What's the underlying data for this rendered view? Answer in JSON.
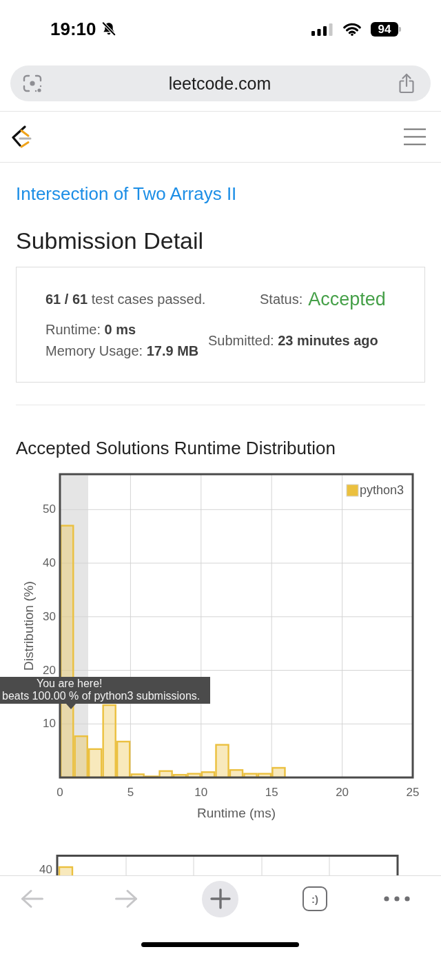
{
  "status_bar": {
    "time": "19:10",
    "battery": "94"
  },
  "address_bar": {
    "url": "leetcode.com"
  },
  "problem_link": "Intersection of Two Arrays II",
  "page_title": "Submission Detail",
  "submission": {
    "cases": "**61 / 61** test cases passed.",
    "status": {
      "label": "Status:",
      "value": "Accepted"
    },
    "runtime": "Runtime: **0 ms**",
    "memory": "Memory Usage: **17.9 MB**",
    "submitted": "Submitted: **23 minutes ago**"
  },
  "distribution": {
    "title": "Accepted Solutions Runtime Distribution",
    "chart_data": {
      "type": "bar",
      "xlabel": "Runtime (ms)",
      "ylabel": "Distribution (%)",
      "x": [
        0.5,
        1.5,
        2.5,
        3.5,
        4.5,
        5.5,
        6.5,
        7.5,
        8.5,
        9.5,
        10.5,
        11.5,
        12.5,
        13.5,
        14.5,
        15.5
      ],
      "series": [
        {
          "name": "python3",
          "color": "#ebc03f",
          "values": [
            47.0,
            7.7,
            5.3,
            13.5,
            6.7,
            0.6,
            0.2,
            1.2,
            0.5,
            0.7,
            1.0,
            6.1,
            1.4,
            0.7,
            0.7,
            1.8
          ]
        }
      ],
      "xlim": [
        0,
        25
      ],
      "ylim": [
        0,
        56.6
      ],
      "xticks": [
        0,
        5,
        10,
        15,
        20,
        25
      ],
      "yticks": [
        10,
        20,
        30,
        40,
        50
      ],
      "grid": true,
      "bands": [
        {
          "axis": "x",
          "from": 0,
          "to": 2
        }
      ]
    },
    "tooltip": {
      "title": "You are here!",
      "text": "beats 100.00 % of python3 submissions."
    }
  },
  "next_chart": {
    "ytick": "40"
  },
  "toolbar": {
    "buttons": [
      {
        "kind": "back",
        "disabled": true
      },
      {
        "kind": "forward",
        "disabled": true
      },
      {
        "kind": "new_tab",
        "disabled": false
      },
      {
        "kind": "tabs",
        "label": ":)",
        "disabled": false
      },
      {
        "kind": "more",
        "disabled": false
      }
    ]
  }
}
